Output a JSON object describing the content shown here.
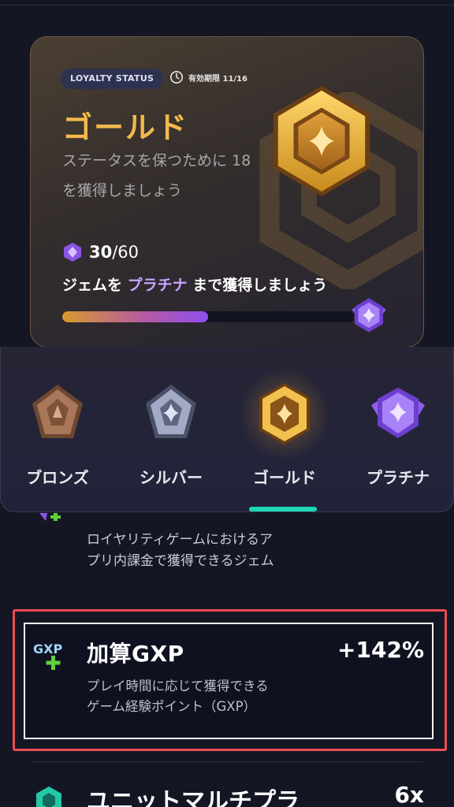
{
  "status_card": {
    "badge": "LOYALTY STATUS",
    "expiry": "有効期限 11/16",
    "tier": "ゴールド",
    "description": "ステータスを保つために 18 を獲得しましょう",
    "gems_current": "30",
    "gems_total": "/60",
    "earn_prefix": "ジェムを ",
    "earn_target": "プラチナ",
    "earn_suffix": " まで獲得しましょう",
    "progress_fraction": 0.5
  },
  "tiers": [
    {
      "label": "ブロンズ",
      "icon": "bronze-medal-icon"
    },
    {
      "label": "シルバー",
      "icon": "silver-medal-icon"
    },
    {
      "label": "ゴールド",
      "icon": "gold-medal-icon",
      "selected": true
    },
    {
      "label": "プラチナ",
      "icon": "platinum-medal-icon"
    }
  ],
  "benefits": {
    "gems": {
      "description": "ロイヤリティゲームにおけるアプリ内課金で獲得できるジェム"
    },
    "gxp": {
      "title": "加算GXP",
      "value": "+142%",
      "description": "プレイ時間に応じて獲得できるゲーム経験ポイント（GXP）",
      "icon_text": "GXP"
    },
    "unit": {
      "title": "ユニットマルチプラ",
      "value": "6x"
    }
  },
  "colors": {
    "gold": "#f3ba4b",
    "accent_purple": "#c9a6ff",
    "tab_indicator": "#1fd6b6",
    "highlight_border": "#ef4b52",
    "gxp_plus": "#5fd13a"
  }
}
